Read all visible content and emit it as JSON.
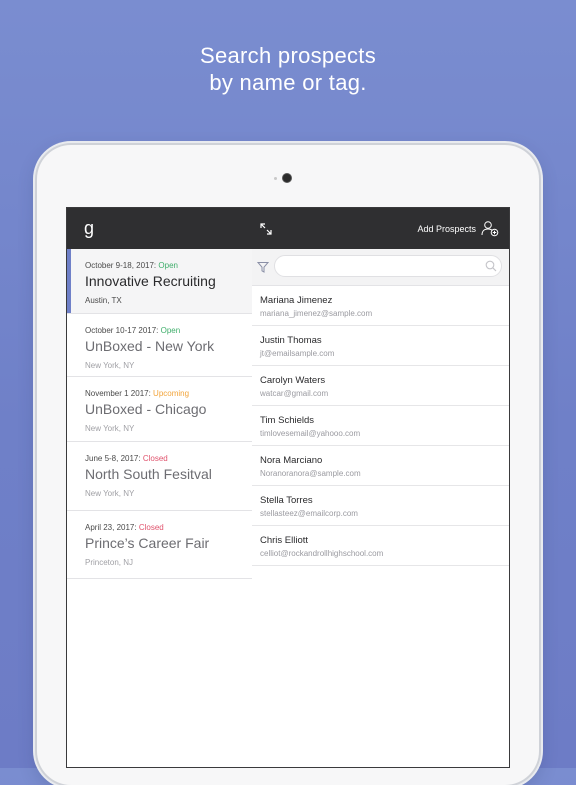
{
  "headline": {
    "line1": "Search prospects",
    "line2": "by name or tag."
  },
  "left_header": {
    "logo": "g"
  },
  "events": [
    {
      "date": "October 9-18, 2017: ",
      "status": "Open",
      "status_type": "open",
      "name": "Innovative Recruiting",
      "place": "Austin, TX",
      "active": true
    },
    {
      "date": "October 10-17 2017: ",
      "status": "Open",
      "status_type": "open",
      "name": "UnBoxed - New York",
      "place": "New York, NY",
      "active": false
    },
    {
      "date": "November 1 2017: ",
      "status": "Upcoming",
      "status_type": "upcoming",
      "name": "UnBoxed - Chicago",
      "place": "New York, NY",
      "active": false
    },
    {
      "date": "June 5-8, 2017: ",
      "status": "Closed",
      "status_type": "closed",
      "name": "North South Fesitval",
      "place": "New York, NY",
      "active": false
    },
    {
      "date": "April 23, 2017: ",
      "status": "Closed",
      "status_type": "closed",
      "name": "Prince’s Career Fair",
      "place": "Princeton, NJ",
      "active": false
    }
  ],
  "right_header": {
    "add_label": "Add Prospects",
    "expand_icon": "expand-icon",
    "add_icon": "add-person-icon"
  },
  "search": {
    "placeholder": "",
    "value": ""
  },
  "contacts": [
    {
      "name": "Mariana Jimenez",
      "email": "mariana_jimenez@sample.com"
    },
    {
      "name": "Justin Thomas",
      "email": "jt@emailsample.com"
    },
    {
      "name": "Carolyn Waters",
      "email": "watcar@gmail.com"
    },
    {
      "name": "Tim Schields",
      "email": "timlovesemail@yahooo.com"
    },
    {
      "name": "Nora Marciano",
      "email": "Noranoranora@sample.com"
    },
    {
      "name": "Stella Torres",
      "email": "stellasteez@emailcorp.com"
    },
    {
      "name": "Chris Elliott",
      "email": "celliot@rockandrollhighschool.com"
    }
  ],
  "colors": {
    "accent": "#6f80c8",
    "open": "#3fae6b",
    "upcoming": "#f2a43a",
    "closed": "#e0536d",
    "header": "#2f2f31"
  }
}
